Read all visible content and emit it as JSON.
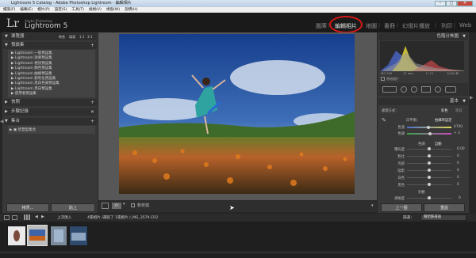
{
  "window": {
    "title": "Lightroom 5 Catalog - Adobe Photoshop Lightroom - 編輯相片",
    "min": "–",
    "max": "□",
    "close": "✕"
  },
  "menu": [
    "檔案(F)",
    "編輯(E)",
    "相片(P)",
    "設定(S)",
    "工具(T)",
    "檢視(V)",
    "視窗(W)",
    "說明(H)"
  ],
  "brand": {
    "mark": "Lr",
    "maker": "Adobe Photoshop",
    "product": "Lightroom 5"
  },
  "modules": [
    "圖庫",
    "編輯相片",
    "地圖",
    "書冊",
    "幻燈片播放",
    "列印",
    "Web"
  ],
  "active_module": "編輯相片",
  "left_panel": {
    "navigator": {
      "title": "導覽器",
      "zoom_options": [
        "符合",
        "填滿",
        "1:1",
        "3:1"
      ]
    },
    "presets": {
      "title": "預設集",
      "items": [
        "Lightroom 一般預設集",
        "Lightroom 效果預設集",
        "Lightroom 視訊預設集",
        "Lightroom 顏色預設集",
        "Lightroom 曲線預設集",
        "Lightroom 銳利化預設集",
        "Lightroom 黑白色調預設集",
        "Lightroom 黑白預設集",
        "使用者預設集"
      ]
    },
    "snapshots": {
      "title": "快照"
    },
    "history": {
      "title": "步驟記錄"
    },
    "collections": {
      "title": "集合",
      "items": [
        "智慧型集合"
      ]
    },
    "copy_button": "拷貝...",
    "paste_button": "貼上"
  },
  "toolbar": {
    "mode": "XY",
    "soft_proof": "軟校樣"
  },
  "right_panel": {
    "histogram": {
      "title": "色階分佈圖",
      "readouts": [
        "ISO 200",
        "17 mm",
        "f / 11",
        "1/100 秒"
      ],
      "original": "原始相片"
    },
    "basic": {
      "title": "基本",
      "treatment_label": "處理方式：",
      "treatment_color": "彩色",
      "treatment_bw": "黑白",
      "wb_label": "白平衡：",
      "wb_value": "拍攝時設定",
      "temp_label": "色溫",
      "temp_value": "4700",
      "tint_label": "色調",
      "tint_value": "+ 3",
      "tone_label": "色調",
      "tone_auto": "自動",
      "sliders": [
        {
          "label": "曝光度",
          "value": "0.00",
          "pos": 0.5
        },
        {
          "label": "對比",
          "value": "0",
          "pos": 0.5
        },
        {
          "label": "亮部",
          "value": "0",
          "pos": 0.5
        },
        {
          "label": "陰影",
          "value": "0",
          "pos": 0.5
        },
        {
          "label": "白色",
          "value": "0",
          "pos": 0.5
        },
        {
          "label": "黑色",
          "value": "0",
          "pos": 0.5
        }
      ],
      "presence_label": "外觀",
      "clarity": {
        "label": "清晰度",
        "value": "0",
        "pos": 0.5
      }
    },
    "prev_button": "上一個",
    "reset_button": "重設"
  },
  "filmstrip_bar": {
    "source": "上次匯入",
    "info": "4張相片 /選取了 1張相片 /_MG_3579.CR2",
    "filter_label": "篩選：",
    "filter_value": "關閉篩選器"
  },
  "photo_colors": {
    "sky": "#3f63a8",
    "flowers": "#c5631e"
  }
}
